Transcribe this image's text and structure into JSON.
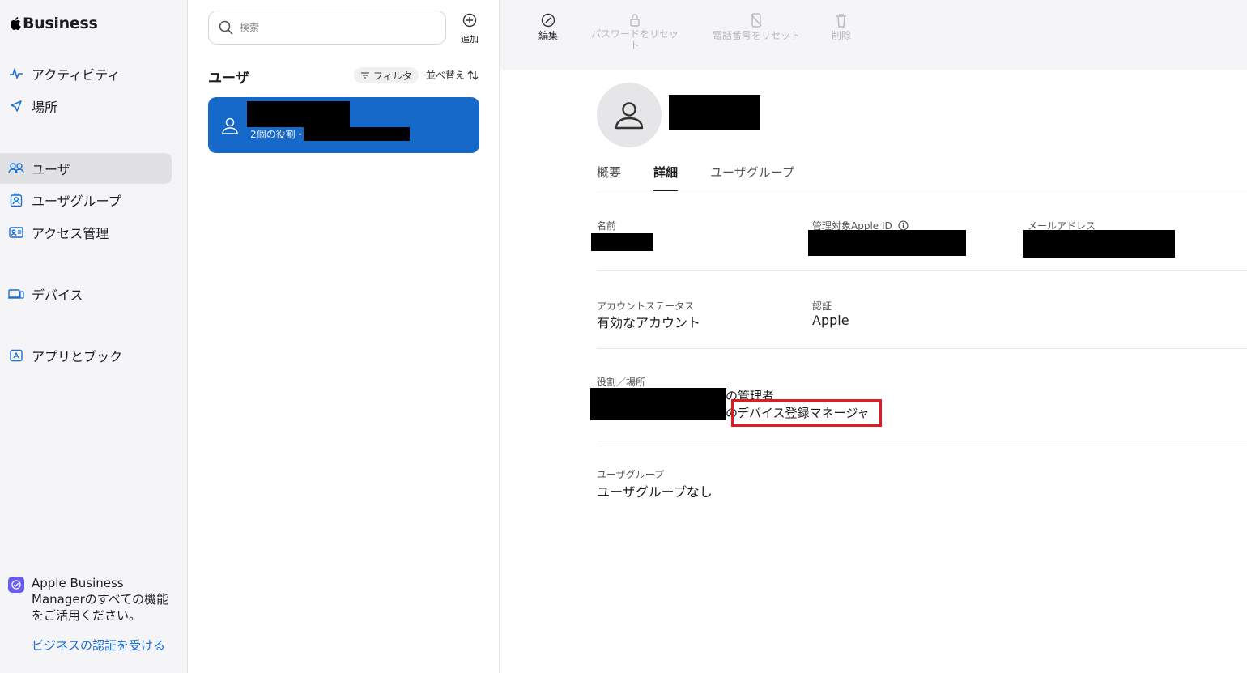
{
  "sidebar": {
    "brand": "Business",
    "items": [
      {
        "label": "アクティビティ",
        "icon": "activity-icon"
      },
      {
        "label": "場所",
        "icon": "location-icon"
      },
      {
        "label": "ユーザ",
        "icon": "users-icon",
        "active": true
      },
      {
        "label": "ユーザグループ",
        "icon": "user-group-icon"
      },
      {
        "label": "アクセス管理",
        "icon": "access-management-icon"
      },
      {
        "label": "デバイス",
        "icon": "devices-icon"
      },
      {
        "label": "アプリとブック",
        "icon": "apps-books-icon"
      }
    ],
    "promo": {
      "text": "Apple Business Managerのすべての機能をご活用ください。",
      "link": "ビジネスの認証を受ける"
    }
  },
  "list": {
    "search_placeholder": "検索",
    "add_label": "追加",
    "title": "ユーザ",
    "filter_label": "フィルタ",
    "sort_label": "並べ替え",
    "selected_user": {
      "roles_text": "2個の役割・"
    }
  },
  "toolbar": {
    "edit": "編集",
    "reset_password": "パスワードをリセット",
    "reset_phone": "電話番号をリセット",
    "delete": "削除"
  },
  "detail": {
    "tabs": [
      "概要",
      "詳細",
      "ユーザグループ"
    ],
    "active_tab": "詳細",
    "fields": {
      "name_label": "名前",
      "managed_apple_id_label": "管理対象Apple ID",
      "email_label": "メールアドレス",
      "account_status_label": "アカウントステータス",
      "account_status_value": "有効なアカウント",
      "auth_label": "認証",
      "auth_value": "Apple",
      "role_location_label": "役割／場所",
      "role_1_suffix": "の管理者",
      "role_2_prefix": "の",
      "role_2_value": "デバイス登録マネージャ",
      "user_group_label": "ユーザグループ",
      "user_group_value": "ユーザグループなし"
    }
  },
  "colors": {
    "accent": "#1769c9",
    "highlight_border": "#e01b22",
    "sidebar_bg": "#f5f5f7"
  }
}
